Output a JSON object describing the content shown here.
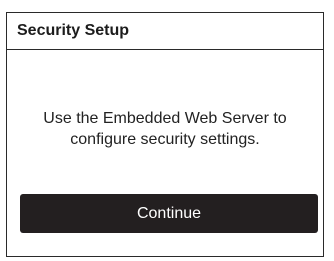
{
  "dialog": {
    "title": "Security Setup",
    "message": "Use the Embedded Web Server to configure security settings.",
    "continue_label": "Continue"
  },
  "colors": {
    "border": "#2a2a2a",
    "button_background": "#231f20",
    "button_text": "#ffffff",
    "text": "#222222"
  }
}
